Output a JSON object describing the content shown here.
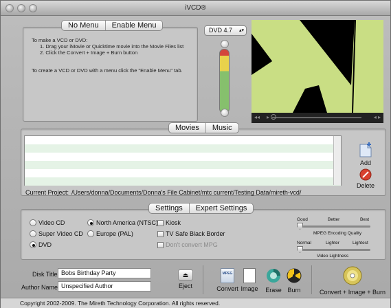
{
  "window": {
    "title": "iVCD®"
  },
  "menu_tabs": {
    "no_menu": "No Menu",
    "enable_menu": "Enable Menu"
  },
  "instructions": {
    "line1": "To make a VCD or DVD:",
    "line2": "1. Drag your iMovie or Quicktime movie into the Movie Files list",
    "line3": "2. Click the Convert + Image + Burn button",
    "line4": "To create a VCD or DVD with a menu click the \"Enable Menu\" tab."
  },
  "disc_size": {
    "selected": "DVD 4.7"
  },
  "capacity_meter": {
    "level": 0.0
  },
  "media_tabs": {
    "movies": "Movies",
    "music": "Music"
  },
  "side_buttons": {
    "add": "Add",
    "delete": "Delete"
  },
  "project": {
    "label": "Current Project:",
    "path": "/Users/donna/Documents/Donna's File Cabinet/mtc current/Testing Data/mireth-vcd/"
  },
  "settings_tabs": {
    "settings": "Settings",
    "expert": "Expert Settings"
  },
  "format": {
    "vcd": "Video CD",
    "svcd": "Super Video CD",
    "dvd": "DVD",
    "selected": "DVD"
  },
  "region": {
    "ntsc": "North America (NTSC)",
    "pal": "Europe (PAL)",
    "selected": "North America (NTSC)"
  },
  "options": {
    "kiosk": "Kiosk",
    "tv_safe": "TV Safe Black Border",
    "dont_convert": "Don't convert MPG"
  },
  "quality_slider": {
    "good": "Good",
    "better": "Better",
    "best": "Best",
    "caption": "MPEG Encoding Quality",
    "value": 0.0
  },
  "lightness_slider": {
    "normal": "Normal",
    "lighter": "Lighter",
    "lightest": "Lightest",
    "caption": "Video Lightness",
    "value": 0.0
  },
  "disk_title": {
    "label": "Disk Title:",
    "value": "Bobs Birthday Party"
  },
  "author_name": {
    "label": "Author Name:",
    "value": "Unspecified Author"
  },
  "toolbar": {
    "eject": "Eject",
    "convert": "Convert",
    "image": "Image",
    "erase": "Erase",
    "burn": "Burn",
    "convert_image_burn": "Convert + Image + Burn",
    "mpeg_badge": "MPEG"
  },
  "footer": {
    "copyright": "Copyright 2002-2009.  The Mireth Technology Corporation. All rights reserved."
  },
  "colors": {
    "list_stripe": "#e5f3e6",
    "preview_shape": "#c9de84",
    "meter_red": "#d3453c",
    "meter_yellow": "#e8d24c",
    "meter_green": "#86c06d"
  }
}
